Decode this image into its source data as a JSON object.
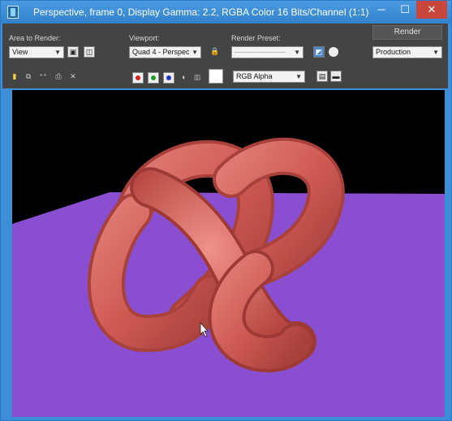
{
  "window": {
    "title": "Perspective, frame 0, Display Gamma: 2.2, RGBA Color 16 Bits/Channel (1:1)",
    "minimize_glyph": "─",
    "maximize_glyph": "☐",
    "close_glyph": "✕"
  },
  "toolbar": {
    "area_label": "Area to Render:",
    "area_value": "View",
    "viewport_label": "Viewport:",
    "viewport_value": "Quad 4 - Perspec",
    "preset_label": "Render Preset:",
    "preset_value": "---------------------",
    "render_button": "Render",
    "render_mode": "Production",
    "channel_display": "RGB Alpha",
    "colors": {
      "red_channel": "#d42020",
      "green_channel": "#1f9a2b",
      "blue_channel": "#1f36c9"
    }
  },
  "viewport": {
    "background": "#000000",
    "ground_color": "#8a4fd0",
    "object_color": "#d05a55",
    "object": "torus-knot"
  }
}
